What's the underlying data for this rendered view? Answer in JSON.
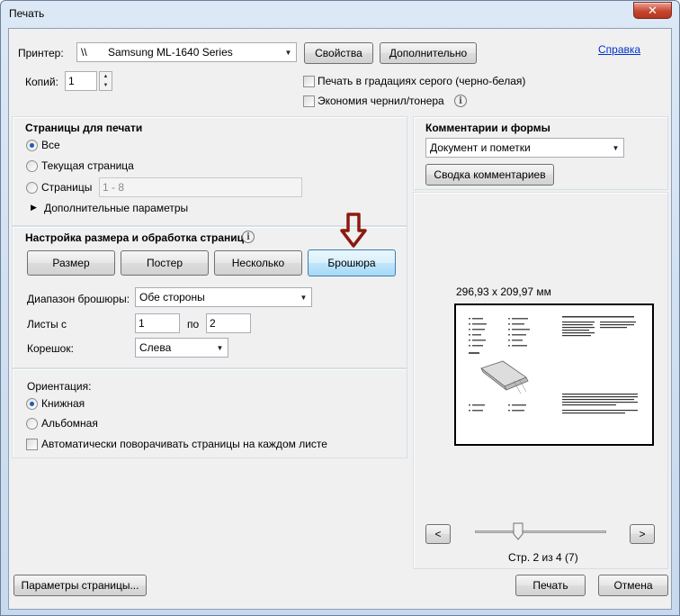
{
  "window": {
    "title": "Печать",
    "close_glyph": "✕"
  },
  "printer": {
    "label": "Принтер:",
    "value": "\\\\       Samsung ML-1640 Series",
    "properties_button": "Свойства",
    "advanced_button": "Дополнительно",
    "help_link": "Справка"
  },
  "copies": {
    "label": "Копий:",
    "value": "1"
  },
  "options": {
    "grayscale": "Печать в градациях серого (черно-белая)",
    "save_ink": "Экономия чернил/тонера"
  },
  "pages": {
    "title": "Страницы для печати",
    "all": "Все",
    "current": "Текущая страница",
    "pages": "Страницы",
    "range_placeholder": "1 - 8",
    "more_options": "Дополнительные параметры"
  },
  "sizing": {
    "title": "Настройка размера и обработка страниц",
    "tabs": [
      "Размер",
      "Постер",
      "Несколько",
      "Брошюра"
    ],
    "booklet_range_label": "Диапазон брошюры:",
    "booklet_range_value": "Обе стороны",
    "sheets_from_label": "Листы с",
    "sheets_from_value": "1",
    "sheets_to_label": "по",
    "sheets_to_value": "2",
    "binding_label": "Корешок:",
    "binding_value": "Слева"
  },
  "orientation": {
    "title": "Ориентация:",
    "portrait": "Книжная",
    "landscape": "Альбомная",
    "auto_rotate": "Автоматически поворачивать страницы на каждом листе"
  },
  "comments": {
    "title": "Комментарии и формы",
    "value": "Документ и пометки",
    "summary_button": "Сводка комментариев"
  },
  "preview": {
    "size": "296,93 x 209,97 мм",
    "prev": "<",
    "next": ">",
    "page_info": "Стр. 2 из 4 (7)",
    "slider_level": 0.33
  },
  "footer": {
    "page_setup": "Параметры страницы...",
    "print": "Печать",
    "cancel": "Отмена"
  },
  "colors": {
    "arrow": "#8b1a10",
    "accent": "#3c7fb1"
  }
}
